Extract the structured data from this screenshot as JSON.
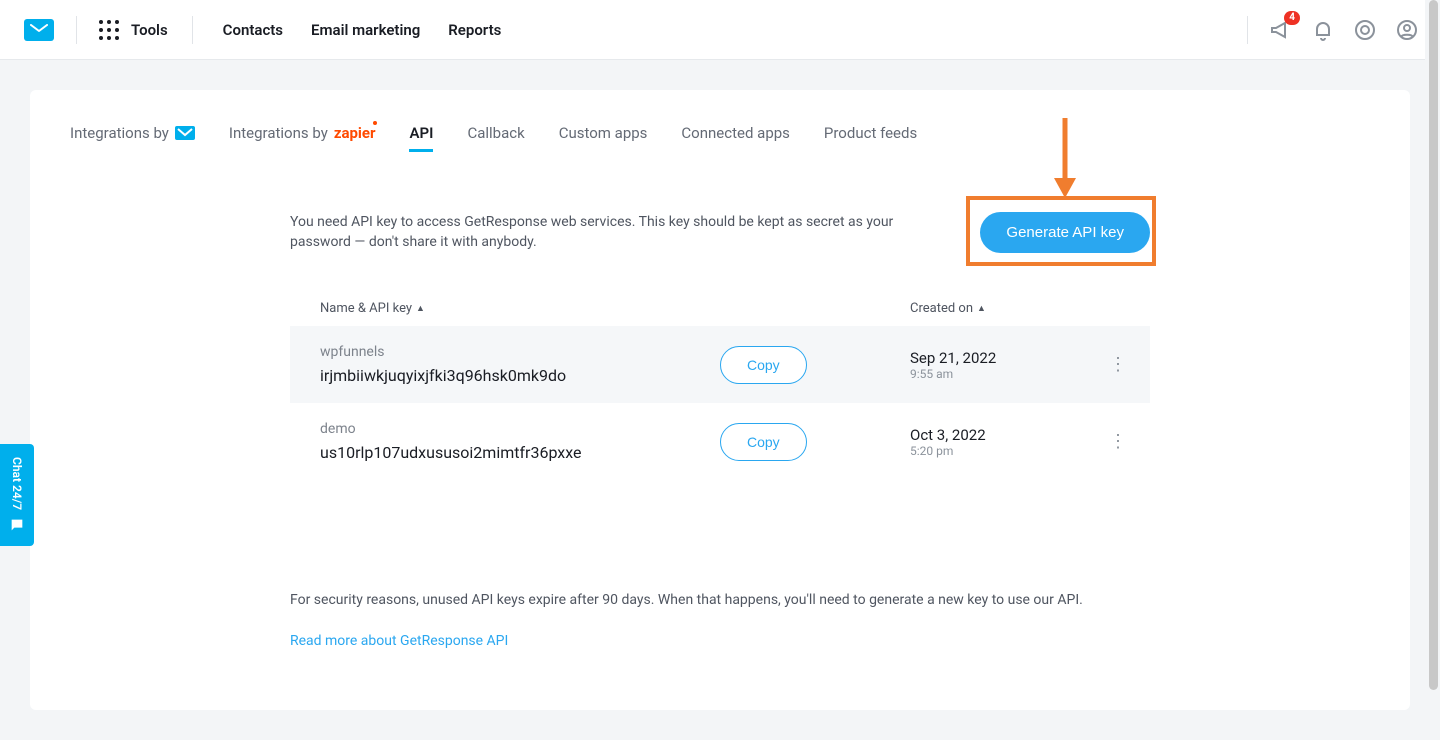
{
  "nav": {
    "tools": "Tools",
    "links": [
      "Contacts",
      "Email marketing",
      "Reports"
    ],
    "badge": "4"
  },
  "tabs": {
    "integrations_by": "Integrations by",
    "integrations_by_zapier_prefix": "Integrations by",
    "zapier": "zapier",
    "api": "API",
    "callback": "Callback",
    "custom_apps": "Custom apps",
    "connected_apps": "Connected apps",
    "product_feeds": "Product feeds"
  },
  "intro": "You need API key to access GetResponse web services. This key should be kept as secret as your password — don't share it with anybody.",
  "generate_label": "Generate API key",
  "columns": {
    "name": "Name & API key",
    "created": "Created on"
  },
  "rows": [
    {
      "name": "wpfunnels",
      "key": "irjmbiiwkjuqyixjfki3q96hsk0mk9do",
      "copy": "Copy",
      "date": "Sep 21, 2022",
      "time": "9:55 am"
    },
    {
      "name": "demo",
      "key": "us10rlp107udxususoi2mimtfr36pxxe",
      "copy": "Copy",
      "date": "Oct 3, 2022",
      "time": "5:20 pm"
    }
  ],
  "footer_note": "For security reasons, unused API keys expire after 90 days. When that happens, you'll need to generate a new key to use our API.",
  "read_more": "Read more about GetResponse API",
  "chat_label": "Chat 24/7"
}
